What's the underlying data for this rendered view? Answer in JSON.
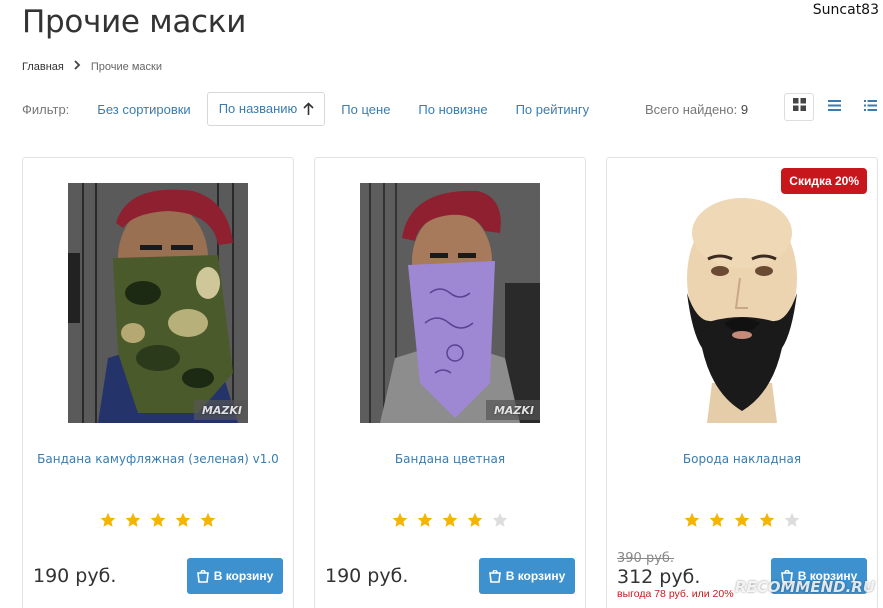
{
  "user": {
    "name": "Suncat83"
  },
  "page": {
    "title": "Прочие маски"
  },
  "breadcrumb": {
    "home": "Главная",
    "current": "Прочие маски"
  },
  "filter": {
    "label": "Фильтр:",
    "options": [
      {
        "label": "Без сортировки",
        "active": false
      },
      {
        "label": "По названию",
        "active": true
      },
      {
        "label": "По цене",
        "active": false
      },
      {
        "label": "По новизне",
        "active": false
      },
      {
        "label": "По рейтингу",
        "active": false
      }
    ],
    "found_label": "Всего найдено:",
    "found_count": "9",
    "sort_direction_icon": "arrow-up-icon"
  },
  "view_modes": [
    {
      "icon": "grid-view-icon",
      "active": true
    },
    {
      "icon": "list-view-icon",
      "active": false
    },
    {
      "icon": "detail-list-view-icon",
      "active": false
    }
  ],
  "products": [
    {
      "name": "Бандана камуфляжная (зеленая) v1.0",
      "price": "190 руб.",
      "rating": 5,
      "image_caption": "MAZKI",
      "cart_label": "В корзину"
    },
    {
      "name": "Бандана цветная",
      "price": "190 руб.",
      "rating": 4,
      "image_caption": "MAZKI",
      "cart_label": "В корзину"
    },
    {
      "name": "Борода накладная",
      "old_price": "390 руб.",
      "price": "312 руб.",
      "saving": "выгода 78 руб. или 20%",
      "rating": 4,
      "discount": "Скидка 20%",
      "cart_label": "В корзину"
    }
  ],
  "watermark": "RECOMMEND.RU",
  "colors": {
    "link": "#3a7cb0",
    "button": "#3e91cf",
    "badge": "#c8161d",
    "star": "#f4b400",
    "star_empty": "#dddddd"
  }
}
